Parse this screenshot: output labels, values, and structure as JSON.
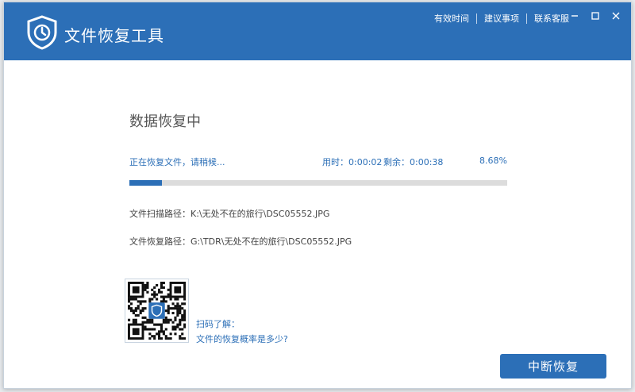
{
  "app": {
    "title": "文件恢复工具"
  },
  "top_links": [
    "有效时间",
    "建议事项",
    "联系客服"
  ],
  "window_controls": [
    "minimize-icon",
    "maximize-icon",
    "close-icon"
  ],
  "main": {
    "title": "数据恢复中",
    "status_text": "正在恢复文件，请稍候...",
    "elapsed": "用时：0:00:02",
    "remaining": "剩余：0:00:38",
    "percent_text": "8.68%",
    "progress": 0.0868,
    "scan_path": "文件扫描路径：K:\\无处不在的旅行\\DSC05552.JPG",
    "recover_path": "文件恢复路径：G:\\TDR\\无处不在的旅行\\DSC05552.JPG"
  },
  "qr": {
    "caption_1": "扫码了解：",
    "caption_2": "文件的恢复概率是多少?"
  },
  "actions": {
    "stop_label": "中断恢复"
  },
  "colors": {
    "accent": "#2c6fb7",
    "track": "#dcdcdc"
  }
}
